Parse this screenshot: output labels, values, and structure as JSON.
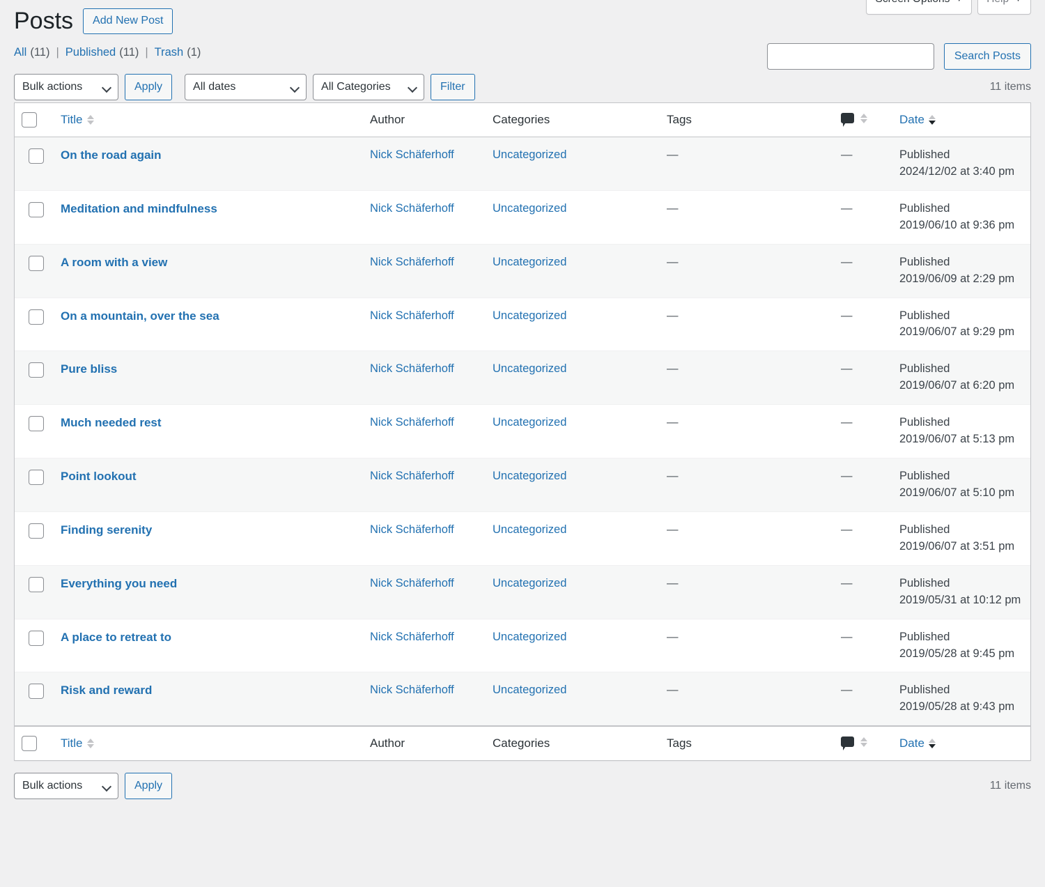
{
  "screen_meta": {
    "screen_options_label": "Screen Options",
    "help_label": "Help",
    "caret": "▼"
  },
  "header": {
    "page_title": "Posts",
    "add_new_label": "Add New Post"
  },
  "status_filters": [
    {
      "label": "All",
      "count": "(11)"
    },
    {
      "label": "Published",
      "count": "(11)"
    },
    {
      "label": "Trash",
      "count": "(1)"
    }
  ],
  "separator": "|",
  "search": {
    "value": "",
    "placeholder": "",
    "submit_label": "Search Posts"
  },
  "tablenav_top": {
    "bulk_actions_label": "Bulk actions",
    "apply_label": "Apply",
    "dates_label": "All dates",
    "categories_label": "All Categories",
    "filter_label": "Filter",
    "displaying_num": "11 items"
  },
  "tablenav_bottom": {
    "bulk_actions_label": "Bulk actions",
    "apply_label": "Apply",
    "displaying_num": "11 items"
  },
  "columns": {
    "title": "Title",
    "author": "Author",
    "categories": "Categories",
    "tags": "Tags",
    "comments_icon": "comment-bubble-icon",
    "date": "Date"
  },
  "sort": {
    "title_state": "none",
    "comments_state": "none",
    "date_state": "desc"
  },
  "rows": [
    {
      "title": "On the road again",
      "author": "Nick Schäferhoff",
      "categories": "Uncategorized",
      "tags": "—",
      "comments": "—",
      "state": "Published",
      "date": "2024/12/02 at 3:40 pm"
    },
    {
      "title": "Meditation and mindfulness",
      "author": "Nick Schäferhoff",
      "categories": "Uncategorized",
      "tags": "—",
      "comments": "—",
      "state": "Published",
      "date": "2019/06/10 at 9:36 pm"
    },
    {
      "title": "A room with a view",
      "author": "Nick Schäferhoff",
      "categories": "Uncategorized",
      "tags": "—",
      "comments": "—",
      "state": "Published",
      "date": "2019/06/09 at 2:29 pm"
    },
    {
      "title": "On a mountain, over the sea",
      "author": "Nick Schäferhoff",
      "categories": "Uncategorized",
      "tags": "—",
      "comments": "—",
      "state": "Published",
      "date": "2019/06/07 at 9:29 pm"
    },
    {
      "title": "Pure bliss",
      "author": "Nick Schäferhoff",
      "categories": "Uncategorized",
      "tags": "—",
      "comments": "—",
      "state": "Published",
      "date": "2019/06/07 at 6:20 pm"
    },
    {
      "title": "Much needed rest",
      "author": "Nick Schäferhoff",
      "categories": "Uncategorized",
      "tags": "—",
      "comments": "—",
      "state": "Published",
      "date": "2019/06/07 at 5:13 pm"
    },
    {
      "title": "Point lookout",
      "author": "Nick Schäferhoff",
      "categories": "Uncategorized",
      "tags": "—",
      "comments": "—",
      "state": "Published",
      "date": "2019/06/07 at 5:10 pm"
    },
    {
      "title": "Finding serenity",
      "author": "Nick Schäferhoff",
      "categories": "Uncategorized",
      "tags": "—",
      "comments": "—",
      "state": "Published",
      "date": "2019/06/07 at 3:51 pm"
    },
    {
      "title": "Everything you need",
      "author": "Nick Schäferhoff",
      "categories": "Uncategorized",
      "tags": "—",
      "comments": "—",
      "state": "Published",
      "date": "2019/05/31 at 10:12 pm"
    },
    {
      "title": "A place to retreat to",
      "author": "Nick Schäferhoff",
      "categories": "Uncategorized",
      "tags": "—",
      "comments": "—",
      "state": "Published",
      "date": "2019/05/28 at 9:45 pm"
    },
    {
      "title": "Risk and reward",
      "author": "Nick Schäferhoff",
      "categories": "Uncategorized",
      "tags": "—",
      "comments": "—",
      "state": "Published",
      "date": "2019/05/28 at 9:43 pm"
    }
  ],
  "colors": {
    "link": "#2271b1",
    "page_bg": "#f0f0f1",
    "row_alt": "#f6f7f7",
    "border": "#c3c4c7"
  }
}
